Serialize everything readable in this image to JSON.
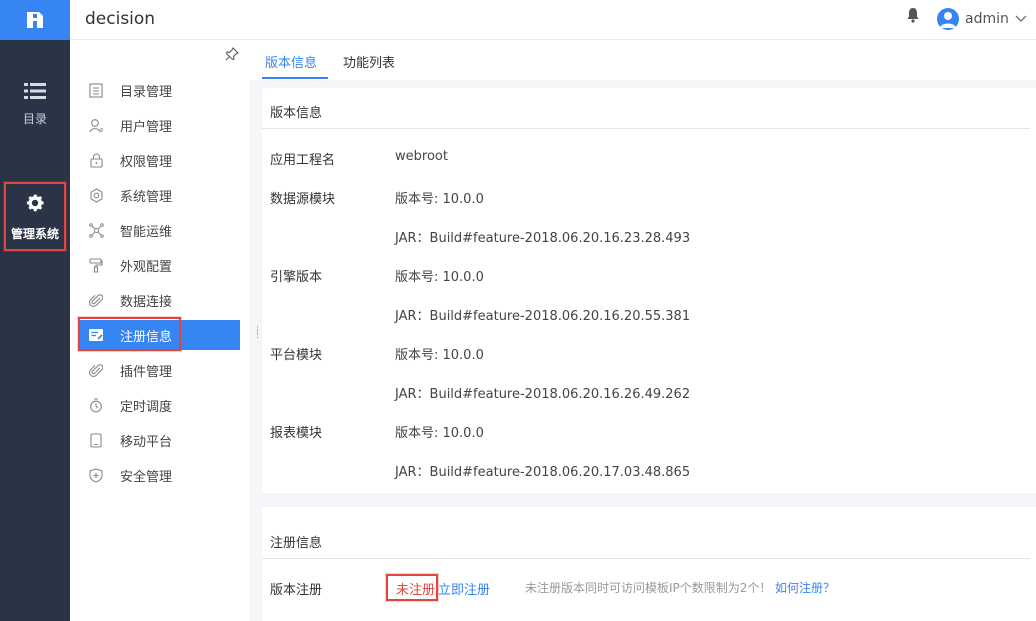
{
  "app": {
    "title": "decision"
  },
  "rail": {
    "catalog_label": "目录",
    "admin_label": "管理系统"
  },
  "header": {
    "username": "admin"
  },
  "sidebar": {
    "items": [
      {
        "label": "目录管理",
        "icon": "catalog-manage-icon"
      },
      {
        "label": "用户管理",
        "icon": "user-manage-icon"
      },
      {
        "label": "权限管理",
        "icon": "lock-icon"
      },
      {
        "label": "系统管理",
        "icon": "gear-icon"
      },
      {
        "label": "智能运维",
        "icon": "ops-icon"
      },
      {
        "label": "外观配置",
        "icon": "paint-roller-icon"
      },
      {
        "label": "数据连接",
        "icon": "paperclip-icon"
      },
      {
        "label": "注册信息",
        "icon": "register-icon"
      },
      {
        "label": "插件管理",
        "icon": "paperclip-icon"
      },
      {
        "label": "定时调度",
        "icon": "timer-icon"
      },
      {
        "label": "移动平台",
        "icon": "mobile-icon"
      },
      {
        "label": "安全管理",
        "icon": "shield-icon"
      }
    ],
    "active_index": 7
  },
  "tabs": [
    {
      "label": "版本信息",
      "active": true
    },
    {
      "label": "功能列表",
      "active": false
    }
  ],
  "version_panel": {
    "heading": "版本信息",
    "rows": [
      {
        "label": "应用工程名",
        "value": "webroot"
      },
      {
        "label": "数据源模块",
        "value": "版本号: 10.0.0"
      },
      {
        "label": "",
        "value": "JAR：Build#feature-2018.06.20.16.23.28.493"
      },
      {
        "label": "引擎版本",
        "value": "版本号: 10.0.0"
      },
      {
        "label": "",
        "value": "JAR：Build#feature-2018.06.20.16.20.55.381"
      },
      {
        "label": "平台模块",
        "value": "版本号: 10.0.0"
      },
      {
        "label": "",
        "value": "JAR：Build#feature-2018.06.20.16.26.49.262"
      },
      {
        "label": "报表模块",
        "value": "版本号: 10.0.0"
      },
      {
        "label": "",
        "value": "JAR：Build#feature-2018.06.20.17.03.48.865"
      }
    ]
  },
  "register_panel": {
    "heading": "注册信息",
    "row_label": "版本注册",
    "status": "未注册",
    "register_now": "立即注册",
    "note": "未注册版本同时可访问模板IP个数限制为2个！",
    "how_link": "如何注册？"
  },
  "colors": {
    "accent": "#3685f2",
    "rail_bg": "#2b3446",
    "highlight_red": "#e0463d"
  }
}
